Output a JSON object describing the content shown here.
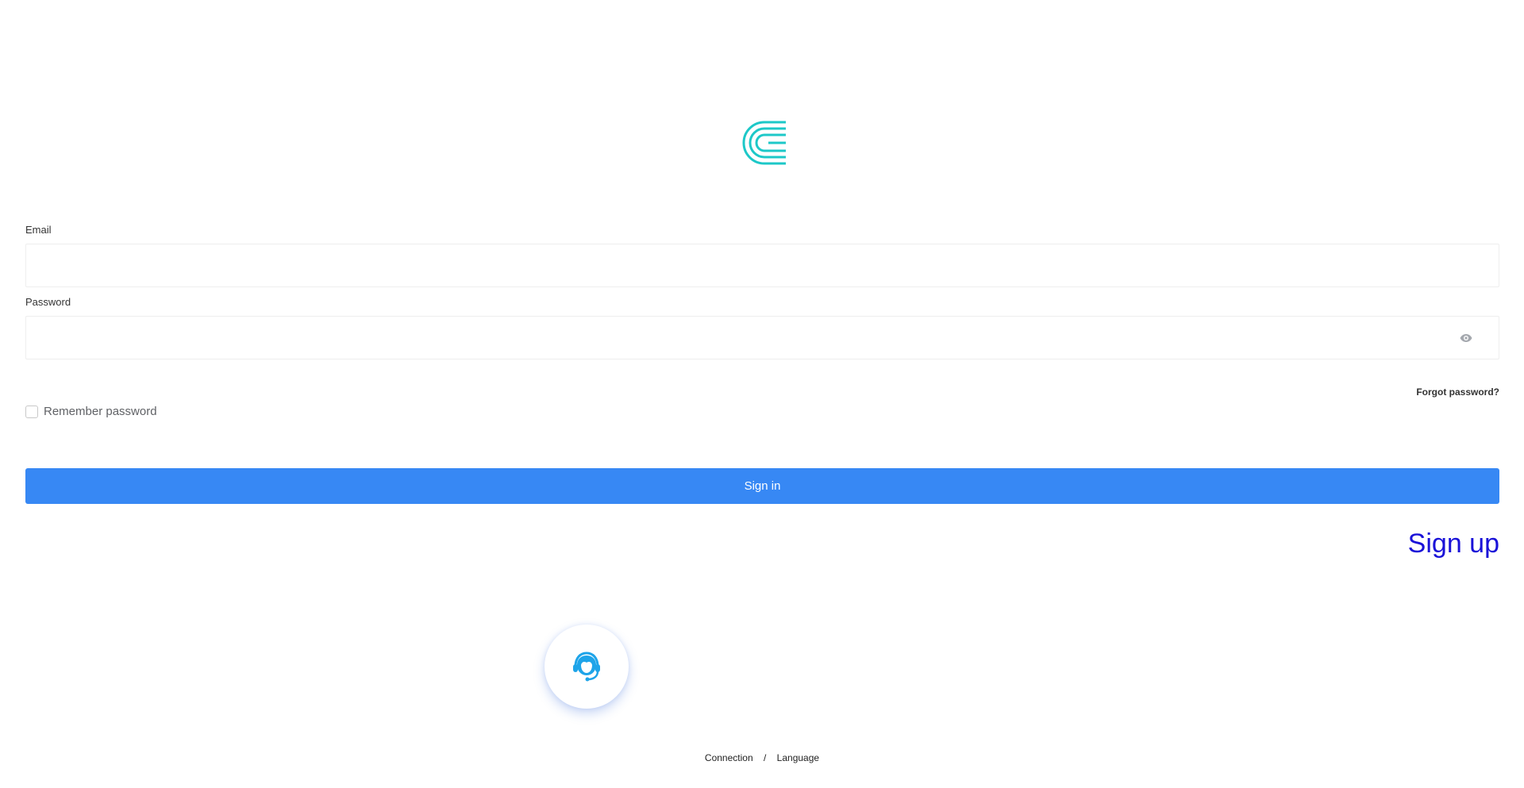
{
  "brand": {
    "accent_color": "#1dc8c8",
    "logo_icon": "brand-logo-icon"
  },
  "login_form": {
    "email_label": "Email",
    "email_value": "",
    "email_placeholder": "",
    "password_label": "Password",
    "password_value": "",
    "password_placeholder": "",
    "password_toggle_icon": "eye-icon",
    "forgot_password": "Forgot password?",
    "remember_password": "Remember password",
    "remember_checked": false,
    "signin_button": "Sign in",
    "signin_color": "#3788f4",
    "signup_link": "Sign up",
    "signup_color": "#1a12d8"
  },
  "support": {
    "icon": "customer-support-headset-icon",
    "icon_color": "#1ea4e9"
  },
  "footer": {
    "connection": "Connection",
    "separator": "/",
    "language": "Language"
  }
}
